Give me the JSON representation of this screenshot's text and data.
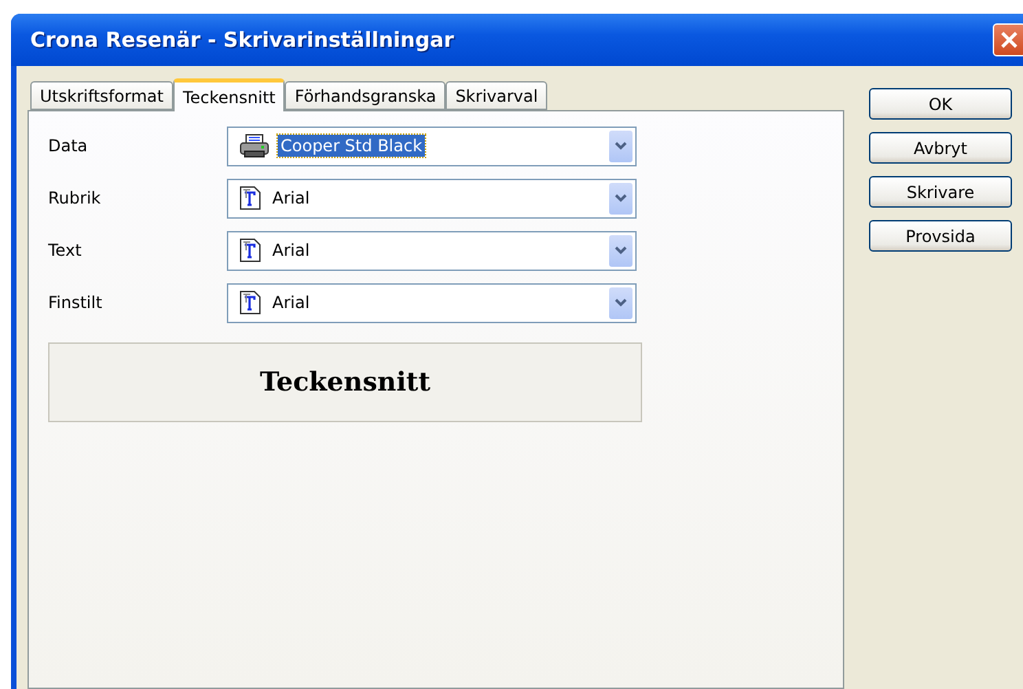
{
  "window": {
    "title": "Crona Resenär - Skrivarinställningar"
  },
  "tabs": [
    {
      "label": "Utskriftsformat",
      "selected": false
    },
    {
      "label": "Teckensnitt",
      "selected": true
    },
    {
      "label": "Förhandsgranska",
      "selected": false
    },
    {
      "label": "Skrivarval",
      "selected": false
    }
  ],
  "fonts": [
    {
      "label": "Data",
      "value": "Cooper Std Black",
      "kind": "printer",
      "highlighted": true
    },
    {
      "label": "Rubrik",
      "value": "Arial",
      "kind": "truetype",
      "highlighted": false
    },
    {
      "label": "Text",
      "value": "Arial",
      "kind": "truetype",
      "highlighted": false
    },
    {
      "label": "Finstilt",
      "value": "Arial",
      "kind": "truetype",
      "highlighted": false
    }
  ],
  "preview": {
    "text": "Teckensnitt"
  },
  "buttons": [
    "OK",
    "Avbryt",
    "Skrivare",
    "Provsida"
  ]
}
